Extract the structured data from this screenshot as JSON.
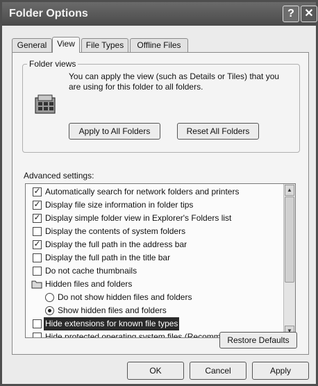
{
  "window": {
    "title": "Folder Options",
    "help_label": "?",
    "close_label": "✕"
  },
  "tabs": [
    {
      "label": "General",
      "selected": false
    },
    {
      "label": "View",
      "selected": true
    },
    {
      "label": "File Types",
      "selected": false
    },
    {
      "label": "Offline Files",
      "selected": false
    }
  ],
  "folder_views": {
    "legend": "Folder views",
    "icon": "folder-views-icon",
    "description": "You can apply the view (such as Details or Tiles) that you are using for this folder to all folders.",
    "apply_label": "Apply to All Folders",
    "reset_label": "Reset All Folders"
  },
  "advanced": {
    "label": "Advanced settings:",
    "items": [
      {
        "type": "checkbox",
        "checked": true,
        "label": "Automatically search for network folders and printers"
      },
      {
        "type": "checkbox",
        "checked": true,
        "label": "Display file size information in folder tips"
      },
      {
        "type": "checkbox",
        "checked": true,
        "label": "Display simple folder view in Explorer's Folders list"
      },
      {
        "type": "checkbox",
        "checked": false,
        "label": "Display the contents of system folders"
      },
      {
        "type": "checkbox",
        "checked": true,
        "label": "Display the full path in the address bar"
      },
      {
        "type": "checkbox",
        "checked": false,
        "label": "Display the full path in the title bar"
      },
      {
        "type": "checkbox",
        "checked": false,
        "label": "Do not cache thumbnails"
      },
      {
        "type": "folder",
        "label": "Hidden files and folders"
      },
      {
        "type": "radio",
        "checked": false,
        "label": "Do not show hidden files and folders"
      },
      {
        "type": "radio",
        "checked": true,
        "label": "Show hidden files and folders"
      },
      {
        "type": "checkbox",
        "checked": false,
        "highlighted": true,
        "label": "Hide extensions for known file types"
      },
      {
        "type": "checkbox",
        "checked": false,
        "label": "Hide protected operating system files (Recommended)"
      }
    ],
    "check_glyph": "✓",
    "scroll_up": "▲",
    "scroll_down": "▼"
  },
  "restore_label": "Restore Defaults",
  "footer": {
    "ok_label": "OK",
    "cancel_label": "Cancel",
    "apply_label": "Apply"
  }
}
